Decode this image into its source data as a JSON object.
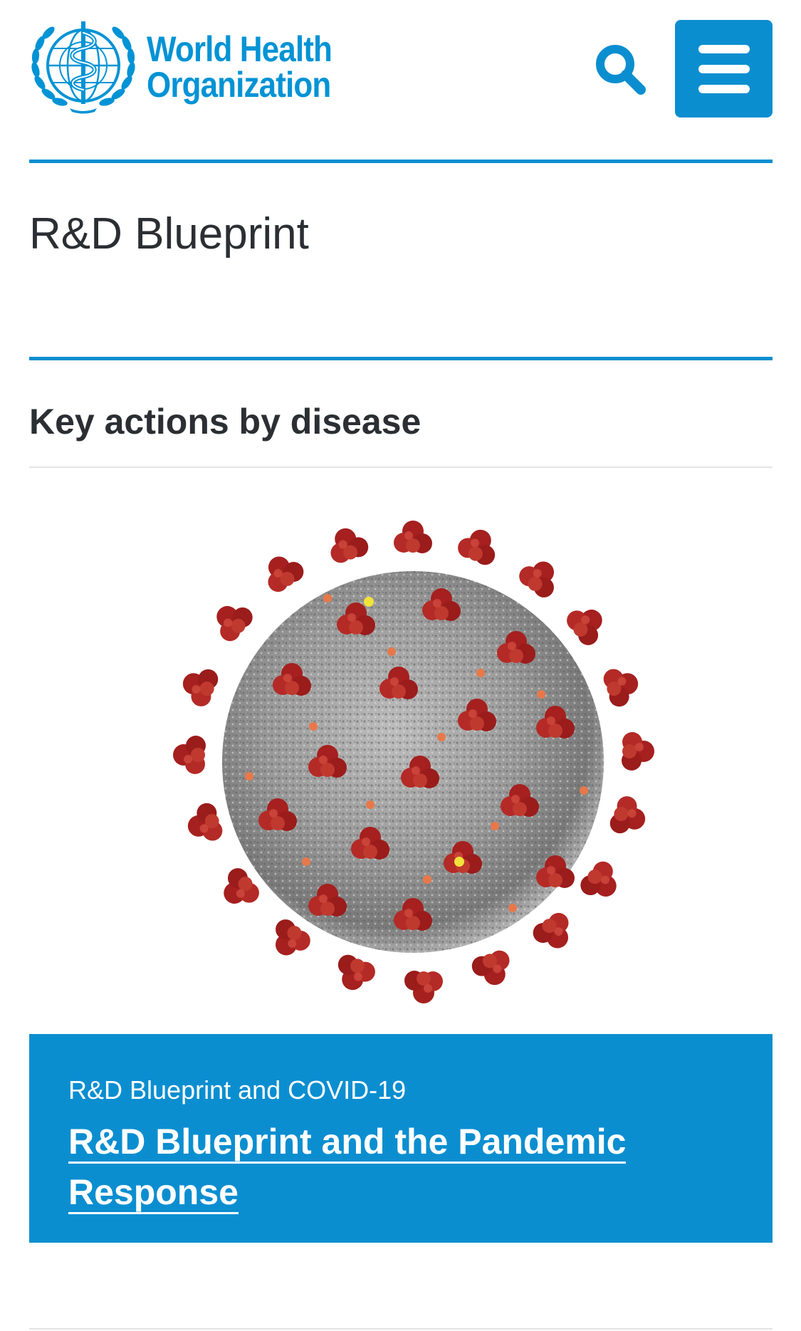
{
  "header": {
    "logo_line1": "World Health",
    "logo_line2": "Organization",
    "search_label": "Search",
    "menu_label": "Menu"
  },
  "page": {
    "title": "R&D Blueprint"
  },
  "section": {
    "heading": "Key actions by disease"
  },
  "card": {
    "image_icon": "coronavirus-illustration",
    "kicker": "R&D Blueprint and COVID-19",
    "link_line1": "R&D Blueprint and the Pandemic",
    "link_line2": "Response"
  },
  "colors": {
    "brand_blue": "#0b8ed0",
    "logo_blue": "#0093d5",
    "text_dark": "#2b2f33",
    "virus_red": "#a5201f",
    "virus_grey": "#8f8f8f"
  }
}
